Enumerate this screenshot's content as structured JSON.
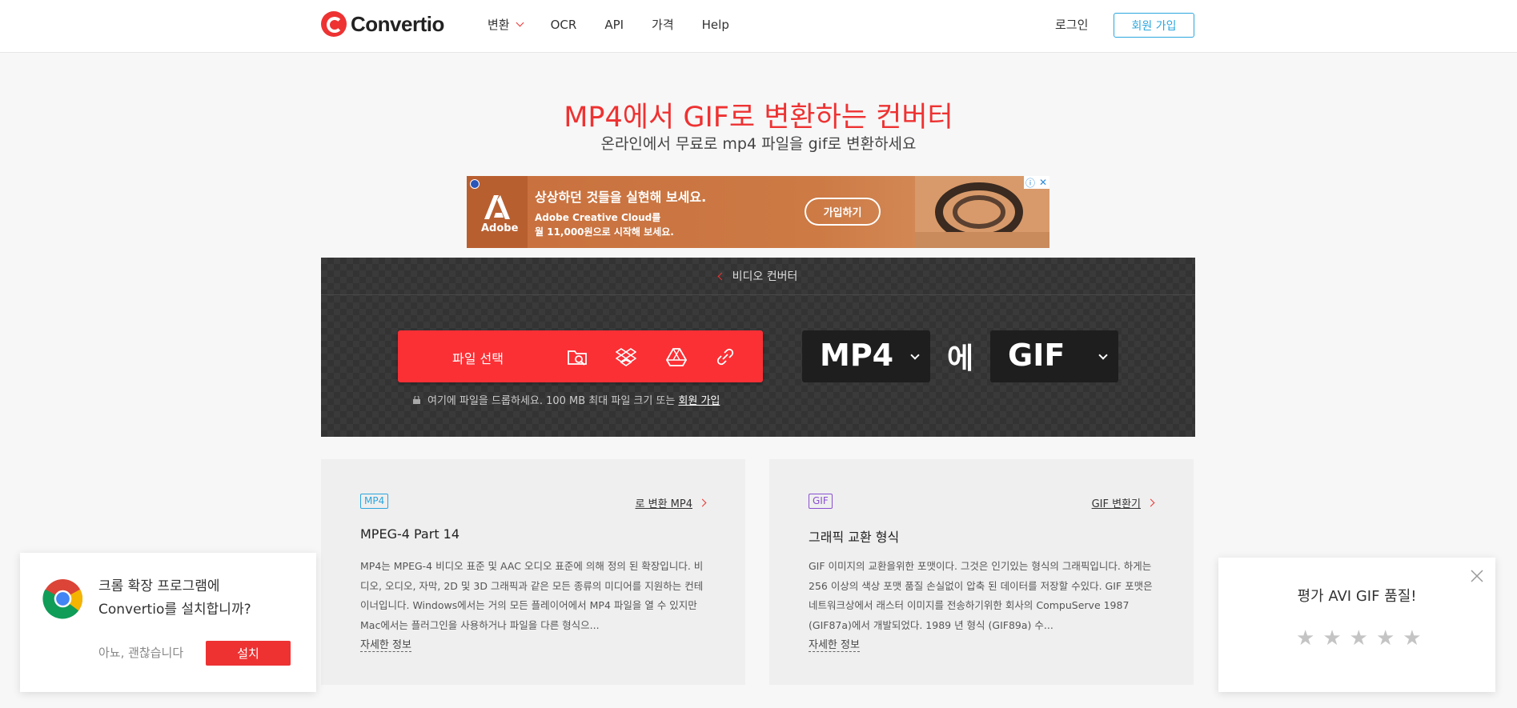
{
  "header": {
    "logo": "Convertio",
    "nav": [
      {
        "label": "변환",
        "has_caret": true
      },
      {
        "label": "OCR"
      },
      {
        "label": "API"
      },
      {
        "label": "가격"
      },
      {
        "label": "Help"
      }
    ],
    "login_label": "로그인",
    "signup_label": "회원 가입"
  },
  "hero": {
    "title": "MP4에서 GIF로 변환하는 컨버터",
    "subtitle": "온라인에서 무료로 mp4 파일을 gif로 변환하세요"
  },
  "ad": {
    "brand": "Adobe",
    "headline": "상상하던 것들을 실현해 보세요.",
    "body_line1": "Adobe Creative Cloud를",
    "body_line2": "월 11,000원으로 시작해 보세요.",
    "cta": "가입하기",
    "info_icon": "info-icon",
    "close_icon": "close-icon"
  },
  "converter": {
    "breadcrumb": "비디오 컨버터",
    "choose_files_label": "파일 선택",
    "sources": [
      "folder-search-icon",
      "dropbox-icon",
      "google-drive-icon",
      "link-icon"
    ],
    "drop_hint": "여기에 파일을 드롭하세요. 100 MB 최대 파일 크기 또는",
    "drop_hint_link": "회원 가입",
    "from_format": "MP4",
    "to_word": "에",
    "to_format": "GIF"
  },
  "cards": [
    {
      "tag": "MP4",
      "tag_color": "#2ba6de",
      "link": "로 변환 MP4",
      "title": "MPEG-4 Part 14",
      "description": "MP4는 MPEG-4 비디오 표준 및 AAC 오디오 표준에 의해 정의 된 확장입니다. 비디오, 오디오, 자막, 2D 및 3D 그래픽과 같은 모든 종류의 미디어를 지원하는 컨테이너입니다. Windows에서는 거의 모든 플레이어에서 MP4 파일을 열 수 있지만 Mac에서는 플러그인을 사용하거나 파일을 다른 형식으...",
      "more": "자세한 정보"
    },
    {
      "tag": "GIF",
      "tag_color": "#8a4fd1",
      "link": "GIF 변환기",
      "title": "그래픽 교환 형식",
      "description": "GIF 이미지의 교환을위한 포맷이다. 그것은 인기있는 형식의 그래픽입니다. 하게는 256 이상의 색상 포맷 품질 손실없이 압축 된 데이터를 저장할 수있다. GIF 포맷은 네트워크상에서 래스터 이미지를 전송하기위한 회사의 CompuServe 1987 (GIF87a)에서 개발되었다. 1989 년 형식 (GIF89a) 수...",
      "more": "자세한 정보"
    }
  ],
  "chrome_popup": {
    "message_line1": "크롬 확장 프로그램에",
    "message_line2": "Convertio를 설치합니까?",
    "decline": "아뇨, 괜찮습니다",
    "install": "설치"
  },
  "rating_popup": {
    "title": "평가 AVI GIF 품질!",
    "stars": 5,
    "rating": 0
  },
  "colors": {
    "brand_red": "#ee3232",
    "accent_blue": "#2ba6de",
    "panel_dark": "#3a3a3a"
  }
}
